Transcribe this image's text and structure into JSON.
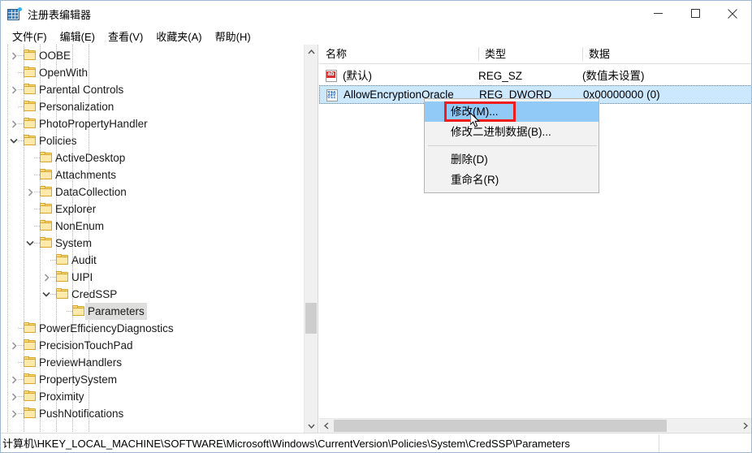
{
  "window": {
    "title": "注册表编辑器",
    "icon": "registry-grid-icon",
    "controls": {
      "minimize": "minimize-icon",
      "maximize": "maximize-icon",
      "close": "close-icon"
    }
  },
  "menubar": {
    "items": [
      {
        "label": "文件(F)"
      },
      {
        "label": "编辑(E)"
      },
      {
        "label": "查看(V)"
      },
      {
        "label": "收藏夹(A)"
      },
      {
        "label": "帮助(H)"
      }
    ]
  },
  "tree": {
    "rows": [
      {
        "label": "OOBE",
        "indent": 6,
        "twisty": "collapsed",
        "selected": false
      },
      {
        "label": "OpenWith",
        "indent": 6,
        "twisty": "none",
        "selected": false
      },
      {
        "label": "Parental Controls",
        "indent": 6,
        "twisty": "collapsed",
        "selected": false
      },
      {
        "label": "Personalization",
        "indent": 6,
        "twisty": "none",
        "selected": false
      },
      {
        "label": "PhotoPropertyHandler",
        "indent": 6,
        "twisty": "collapsed",
        "selected": false
      },
      {
        "label": "Policies",
        "indent": 6,
        "twisty": "expanded",
        "selected": false
      },
      {
        "label": "ActiveDesktop",
        "indent": 7,
        "twisty": "none",
        "selected": false
      },
      {
        "label": "Attachments",
        "indent": 7,
        "twisty": "none",
        "selected": false
      },
      {
        "label": "DataCollection",
        "indent": 7,
        "twisty": "collapsed",
        "selected": false
      },
      {
        "label": "Explorer",
        "indent": 7,
        "twisty": "none",
        "selected": false
      },
      {
        "label": "NonEnum",
        "indent": 7,
        "twisty": "none",
        "selected": false
      },
      {
        "label": "System",
        "indent": 7,
        "twisty": "expanded",
        "selected": false
      },
      {
        "label": "Audit",
        "indent": 8,
        "twisty": "none",
        "selected": false
      },
      {
        "label": "UIPI",
        "indent": 8,
        "twisty": "collapsed",
        "selected": false
      },
      {
        "label": "CredSSP",
        "indent": 8,
        "twisty": "expanded",
        "selected": false
      },
      {
        "label": "Parameters",
        "indent": 9,
        "twisty": "none",
        "selected": true
      },
      {
        "label": "PowerEfficiencyDiagnostics",
        "indent": 6,
        "twisty": "none",
        "selected": false
      },
      {
        "label": "PrecisionTouchPad",
        "indent": 6,
        "twisty": "collapsed",
        "selected": false
      },
      {
        "label": "PreviewHandlers",
        "indent": 6,
        "twisty": "none",
        "selected": false
      },
      {
        "label": "PropertySystem",
        "indent": 6,
        "twisty": "collapsed",
        "selected": false
      },
      {
        "label": "Proximity",
        "indent": 6,
        "twisty": "collapsed",
        "selected": false
      },
      {
        "label": "PushNotifications",
        "indent": 6,
        "twisty": "collapsed",
        "selected": false
      }
    ]
  },
  "list": {
    "columns": [
      "名称",
      "类型",
      "数据"
    ],
    "rows": [
      {
        "icon": "string-value-icon",
        "name": "(默认)",
        "type": "REG_SZ",
        "data": "(数值未设置)",
        "selected": false
      },
      {
        "icon": "dword-value-icon",
        "name": "AllowEncryptionOracle",
        "type": "REG_DWORD",
        "data": "0x00000000 (0)",
        "selected": true
      }
    ]
  },
  "context_menu": {
    "items": [
      {
        "label": "修改(M)...",
        "highlighted": true,
        "separator_after": false
      },
      {
        "label": "修改二进制数据(B)...",
        "highlighted": false,
        "separator_after": true
      },
      {
        "label": "删除(D)",
        "highlighted": false,
        "separator_after": false
      },
      {
        "label": "重命名(R)",
        "highlighted": false,
        "separator_after": false
      }
    ]
  },
  "annotation": {
    "color": "#ee1c1c",
    "target": "修改(M)..."
  },
  "statusbar": {
    "path": "计算机\\HKEY_LOCAL_MACHINE\\SOFTWARE\\Microsoft\\Windows\\CurrentVersion\\Policies\\System\\CredSSP\\Parameters"
  },
  "colors": {
    "selection_blue": "#cce8ff",
    "menu_highlight": "#91c9f7",
    "tree_selection": "#dededd",
    "folder": "#fcd976",
    "annotation_red": "#ee1c1c"
  }
}
